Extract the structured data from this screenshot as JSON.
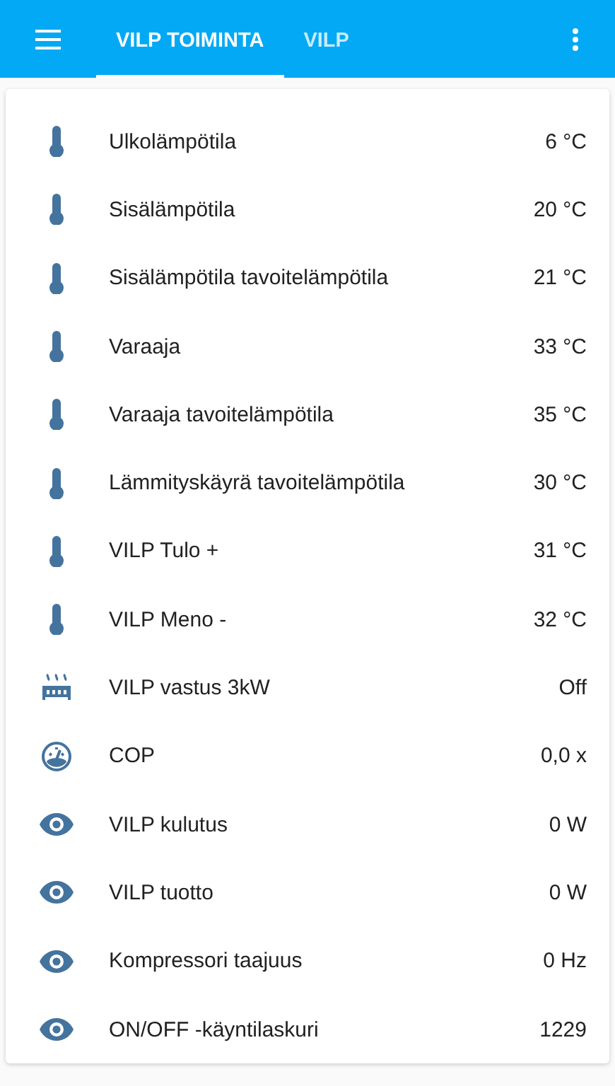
{
  "toolbar": {
    "tabs": [
      {
        "label": "VILP TOIMINTA",
        "selected": true
      },
      {
        "label": "VILP",
        "selected": false
      }
    ]
  },
  "entities": [
    {
      "kind": "thermometer",
      "name": "Ulkolämpötila",
      "state": "6 °C"
    },
    {
      "kind": "thermometer",
      "name": "Sisälämpötila",
      "state": "20 °C"
    },
    {
      "kind": "thermometer",
      "name": "Sisälämpötila tavoitelämpötila",
      "state": "21 °C"
    },
    {
      "kind": "thermometer",
      "name": "Varaaja",
      "state": "33 °C"
    },
    {
      "kind": "thermometer",
      "name": "Varaaja tavoitelämpötila",
      "state": "35 °C"
    },
    {
      "kind": "thermometer",
      "name": "Lämmityskäyrä tavoitelämpötila",
      "state": "30 °C"
    },
    {
      "kind": "thermometer",
      "name": "VILP Tulo +",
      "state": "31 °C"
    },
    {
      "kind": "thermometer",
      "name": "VILP Meno -",
      "state": "32 °C"
    },
    {
      "kind": "radiator",
      "name": "VILP vastus 3kW",
      "state": "Off"
    },
    {
      "kind": "gauge",
      "name": "COP",
      "state": "0,0 x"
    },
    {
      "kind": "eye",
      "name": "VILP kulutus",
      "state": "0 W"
    },
    {
      "kind": "eye",
      "name": "VILP tuotto",
      "state": "0 W"
    },
    {
      "kind": "eye",
      "name": "Kompressori taajuus",
      "state": "0 Hz"
    },
    {
      "kind": "eye",
      "name": "ON/OFF -käyntilaskuri",
      "state": "1229"
    }
  ]
}
